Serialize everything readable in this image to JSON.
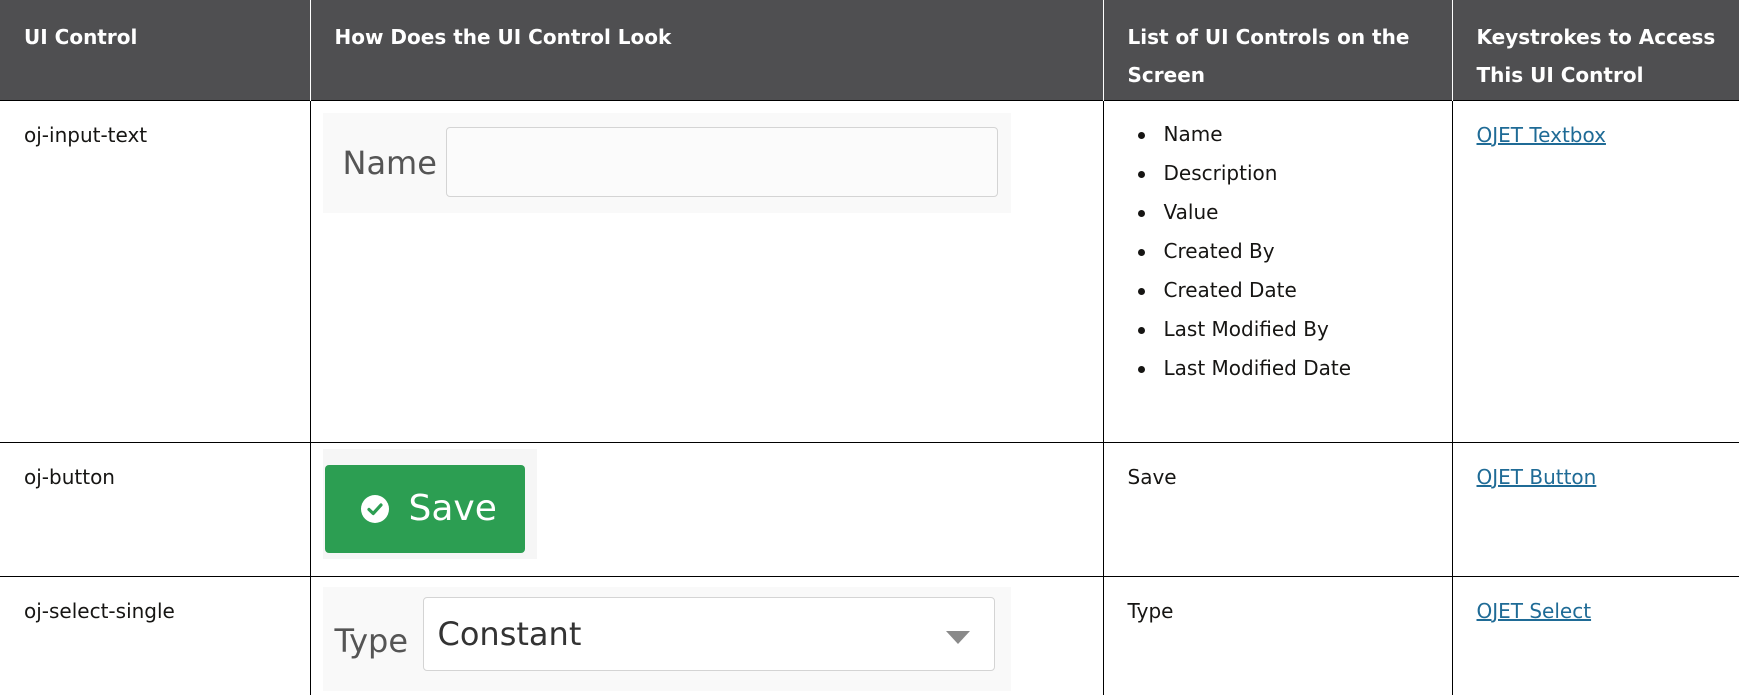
{
  "table": {
    "headers": {
      "ui_control": "UI Control",
      "look": "How Does the UI Control Look",
      "list": "List of UI Controls on the Screen",
      "keystrokes": "Keystrokes to Access This UI Control"
    },
    "rows": [
      {
        "control": "oj-input-text",
        "preview": {
          "label": "Name",
          "value": ""
        },
        "list_items": [
          "Name",
          "Description",
          "Value",
          "Created By",
          "Created Date",
          "Last Modified By",
          "Last Modified Date"
        ],
        "link": "OJET Textbox"
      },
      {
        "control": "oj-button",
        "preview": {
          "label": "Save",
          "icon": "check-circle-icon",
          "color": "#2c9e52"
        },
        "list_text": "Save",
        "link": "OJET Button"
      },
      {
        "control": "oj-select-single",
        "preview": {
          "label": "Type",
          "value": "Constant",
          "icon": "caret-down-icon"
        },
        "list_text": "Type",
        "link": "OJET Select"
      }
    ]
  },
  "colors": {
    "header_bg": "#4f4f51",
    "link": "#1f6b96"
  }
}
